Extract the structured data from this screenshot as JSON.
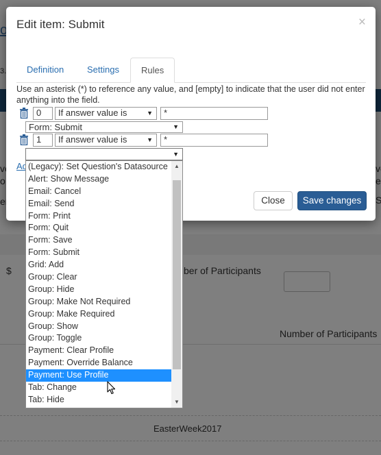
{
  "background": {
    "participants_label": "ber of Participants",
    "participants_header": "Number of Participants",
    "dollar": "$",
    "footer_text": "EasterWeek2017",
    "edge_letters": [
      "o",
      "ve",
      "o",
      "er",
      "ve",
      "e",
      "S"
    ]
  },
  "modal": {
    "title": "Edit item: Submit",
    "close_glyph": "×",
    "tabs": [
      {
        "label": "Definition",
        "active": false
      },
      {
        "label": "Settings",
        "active": false
      },
      {
        "label": "Rules",
        "active": true
      }
    ],
    "hint": "Use an asterisk (*) to reference any value, and [empty] to indicate that the user did not enter anything into the field.",
    "rules": [
      {
        "index": "0",
        "condition": "If answer value is",
        "value": "*",
        "action": "Form: Submit"
      },
      {
        "index": "1",
        "condition": "If answer value is",
        "value": "*",
        "action": ""
      }
    ],
    "add_link": "Ad",
    "buttons": {
      "close": "Close",
      "save": "Save changes"
    }
  },
  "dropdown": {
    "options": [
      "(Legacy): Set Question's Datasource",
      "Alert: Show Message",
      "Email: Cancel",
      "Email: Send",
      "Form: Print",
      "Form: Quit",
      "Form: Save",
      "Form: Submit",
      "Grid: Add",
      "Group: Clear",
      "Group: Hide",
      "Group: Make Not Required",
      "Group: Make Required",
      "Group: Show",
      "Group: Toggle",
      "Payment: Clear Profile",
      "Payment: Override Balance",
      "Payment: Use Profile",
      "Tab: Change",
      "Tab: Hide"
    ],
    "highlighted": "Payment: Use Profile"
  },
  "colors": {
    "primary": "#2a5d95",
    "highlight": "#1e90ff",
    "link": "#2a6eb0"
  },
  "icons": {
    "trash": "trash-icon",
    "close": "close-icon",
    "cursor": "mouse-pointer-icon"
  }
}
